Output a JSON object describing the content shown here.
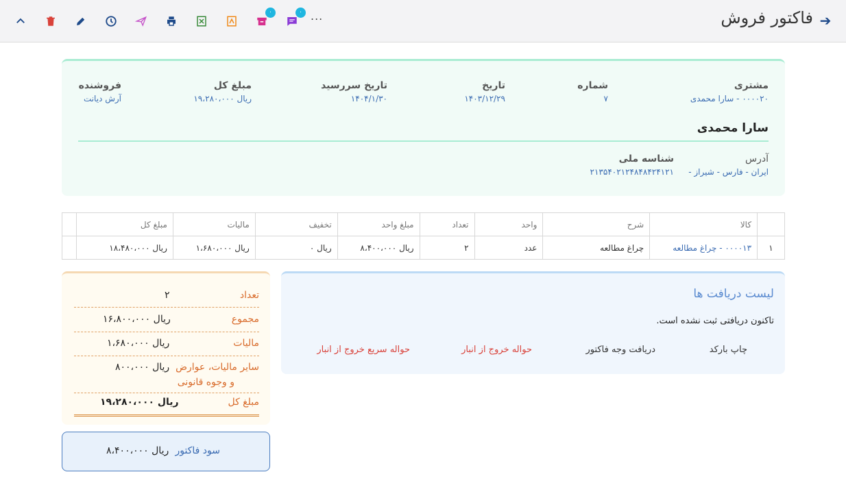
{
  "header": {
    "title": "فاکتور فروش",
    "badge_1": "۰",
    "badge_2": "۰",
    "more": "..."
  },
  "toolbar": {
    "icons": [
      "chevron-up-icon",
      "trash-icon",
      "pencil-icon",
      "clock-icon",
      "send-icon",
      "print-icon",
      "excel-icon",
      "pdf-icon",
      "archive-icon",
      "comment-icon"
    ]
  },
  "invoice": {
    "customer_label": "مشتری",
    "customer_value": "۰۰۰۰۲۰ - سارا محمدی",
    "number_label": "شماره",
    "number_value": "۷",
    "date_label": "تاریخ",
    "date_value": "۱۴۰۳/۱۲/۲۹",
    "due_label": "تاریخ سررسید",
    "due_value": "۱۴۰۴/۱/۳۰",
    "total_label": "مبلغ کل",
    "total_value": "ریال ۱۹،۲۸۰،۰۰۰",
    "seller_label": "فروشنده",
    "seller_value": "آرش دیانت",
    "customer_name": "سارا محمدی",
    "address_label": "آدرس",
    "address_value": "ایران - فارس - شیراز -",
    "national_id_label": "شناسه ملی",
    "national_id_value": "۲۱۳۵۴۰۲۱۲۴۸۴۸۴۲۴۱۲۱"
  },
  "table": {
    "headers": [
      "",
      "کالا",
      "شرح",
      "واحد",
      "تعداد",
      "مبلغ واحد",
      "تخفیف",
      "مالیات",
      "مبلغ کل",
      ""
    ],
    "rows": [
      [
        "۱",
        "۰۰۰۰۱۳ - چراغ مطالعه",
        "چراغ مطالعه",
        "عدد",
        "۲",
        "ریال ۸،۴۰۰،۰۰۰",
        "ریال ۰",
        "ریال ۱،۶۸۰،۰۰۰",
        "ریال ۱۸،۴۸۰،۰۰۰",
        ""
      ]
    ]
  },
  "summary": {
    "count_label": "تعداد",
    "count_value": "۲",
    "subtotal_label": "مجموع",
    "subtotal_value": "ریال ۱۶،۸۰۰،۰۰۰",
    "tax_label": "مالیات",
    "tax_value": "ریال ۱،۶۸۰،۰۰۰",
    "other_tax_label_1": "سایر مالیات، عوارض",
    "other_tax_label_2": "و وجوه قانونی",
    "other_tax_value": "ریال ۸۰۰،۰۰۰",
    "total_label": "مبلغ کل",
    "total_value": "ریال ۱۹،۲۸۰،۰۰۰",
    "profit_label": "سود فاکتور",
    "profit_value": "ریال ۸،۴۰۰،۰۰۰"
  },
  "receipts": {
    "title": "لیست دریافت ها",
    "empty_text": "تاکنون دریافتی ثبت نشده است.",
    "actions": [
      "چاپ بارکد",
      "دریافت وجه فاکتور",
      "حواله خروج از انبار",
      "حواله سریع خروج از انبار"
    ]
  },
  "colors": {
    "accent": "#3a6bb2",
    "header_green": "#a9ecd3",
    "summary_orange": "#d86a2a",
    "receipt_blue": "#5b8bd0",
    "danger": "#d9423a"
  }
}
